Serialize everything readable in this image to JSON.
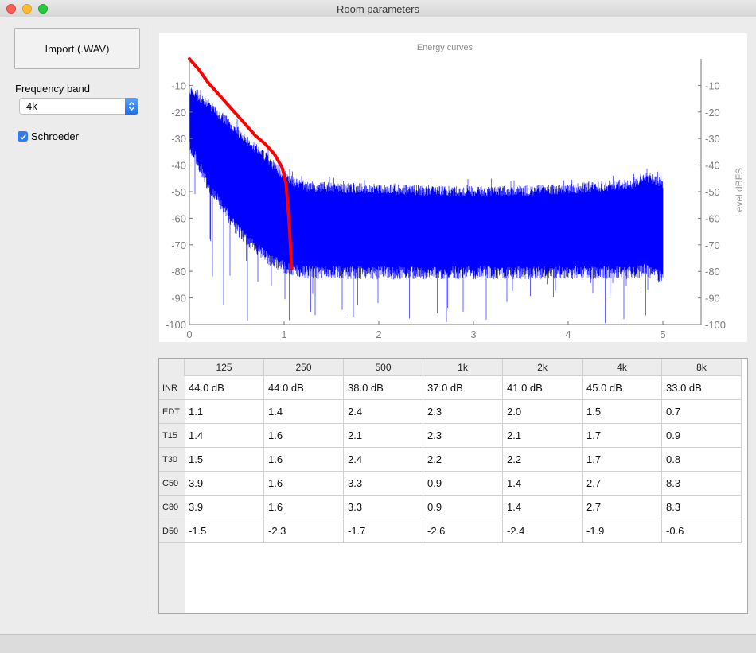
{
  "window": {
    "title": "Room parameters"
  },
  "sidebar": {
    "import_label": "Import (.WAV)",
    "band_label": "Frequency band",
    "band_selected": "4k",
    "schroeder_label": "Schroeder",
    "schroeder_checked": true
  },
  "chart_data": {
    "type": "line",
    "title": "Energy curves",
    "xlabel": "",
    "ylabel": "Level dBFS",
    "xlim": [
      0,
      5
    ],
    "ylim": [
      -100,
      0
    ],
    "x_ticks": [
      "0",
      "1",
      "2",
      "3",
      "4",
      "5"
    ],
    "y_ticks": [
      "-10",
      "-20",
      "-30",
      "-40",
      "-50",
      "-60",
      "-70",
      "-80",
      "-90",
      "-100"
    ],
    "grid": false,
    "series": [
      {
        "color": "#0000ff",
        "style": "dense-noise",
        "envelope_x": [
          0,
          0.2,
          0.5,
          0.8,
          1.0,
          1.2,
          2.0,
          3.0,
          4.0,
          4.7,
          4.8,
          5.0
        ],
        "upper": [
          -10,
          -15,
          -25,
          -35,
          -42,
          -46,
          -47,
          -48,
          -47,
          -45,
          -42,
          -45
        ],
        "lower": [
          -30,
          -45,
          -62,
          -72,
          -76,
          -78,
          -78,
          -78,
          -78,
          -78,
          -77,
          -80
        ],
        "dip_min": -100
      },
      {
        "color": "#ff0000",
        "style": "schroeder",
        "x": [
          0,
          0.1,
          0.2,
          0.3,
          0.4,
          0.5,
          0.6,
          0.7,
          0.8,
          0.9,
          0.98,
          1.02,
          1.05,
          1.07,
          1.08
        ],
        "y": [
          0,
          -4,
          -9,
          -13,
          -17,
          -21,
          -25,
          -29,
          -32,
          -36,
          -41,
          -47,
          -60,
          -72,
          -79
        ]
      }
    ]
  },
  "table": {
    "columns": [
      "125",
      "250",
      "500",
      "1k",
      "2k",
      "4k",
      "8k"
    ],
    "rows": [
      {
        "label": "INR",
        "values": [
          "44.0 dB",
          "44.0 dB",
          "38.0 dB",
          "37.0 dB",
          "41.0 dB",
          "45.0 dB",
          "33.0 dB"
        ]
      },
      {
        "label": "EDT",
        "values": [
          "1.1",
          "1.4",
          "2.4",
          "2.3",
          "2.0",
          "1.5",
          "0.7"
        ]
      },
      {
        "label": "T15",
        "values": [
          "1.4",
          "1.6",
          "2.1",
          "2.3",
          "2.1",
          "1.7",
          "0.9"
        ]
      },
      {
        "label": "T30",
        "values": [
          "1.5",
          "1.6",
          "2.4",
          "2.2",
          "2.2",
          "1.7",
          "0.8"
        ]
      },
      {
        "label": "C50",
        "values": [
          "3.9",
          "1.6",
          "3.3",
          "0.9",
          "1.4",
          "2.7",
          "8.3"
        ]
      },
      {
        "label": "C80",
        "values": [
          "3.9",
          "1.6",
          "3.3",
          "0.9",
          "1.4",
          "2.7",
          "8.3"
        ]
      },
      {
        "label": "D50",
        "values": [
          "-1.5",
          "-2.3",
          "-1.7",
          "-2.6",
          "-2.4",
          "-1.9",
          "-0.6"
        ]
      }
    ]
  }
}
